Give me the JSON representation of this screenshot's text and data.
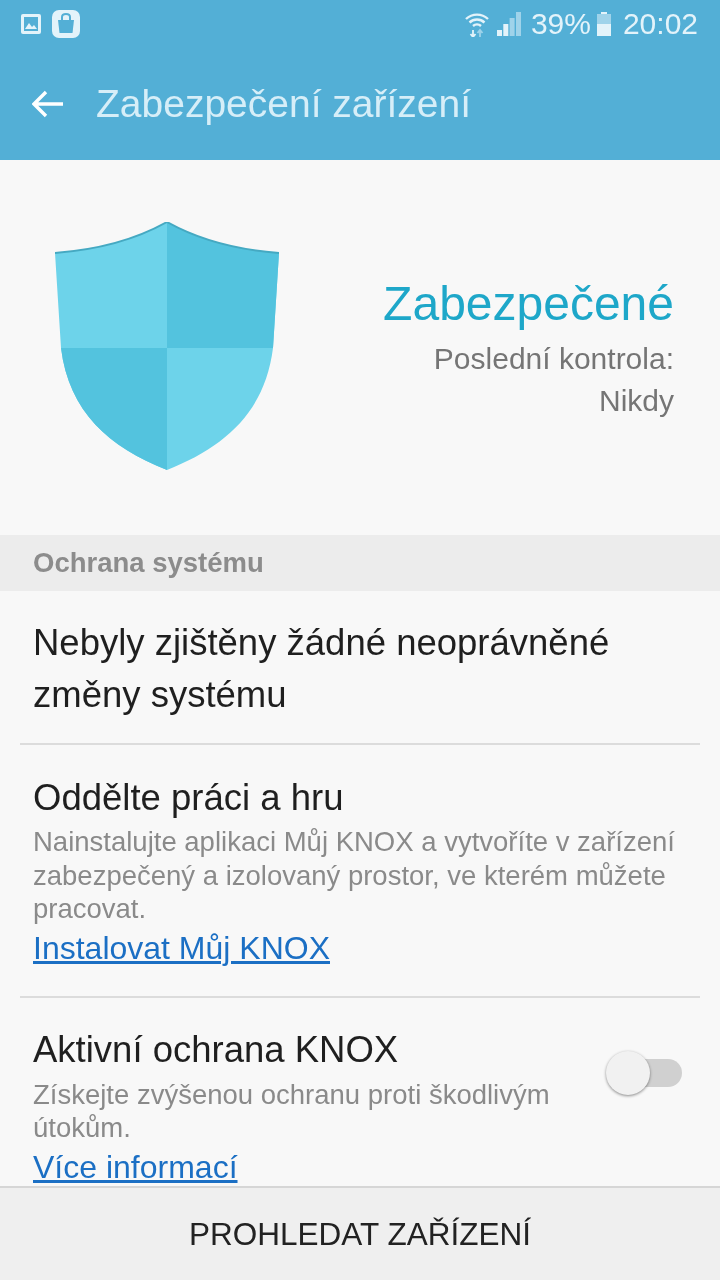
{
  "status_bar": {
    "battery_text": "39%",
    "time": "20:02"
  },
  "app_bar": {
    "title": "Zabezpečení zařízení"
  },
  "status_panel": {
    "status": "Zabezpečené",
    "last_check_label": "Poslední kontrola:",
    "last_check_value": "Nikdy"
  },
  "section": {
    "title": "Ochrana systému"
  },
  "items": [
    {
      "kind": "info",
      "title": "Nebyly zjištěny žádné neoprávněné změny systému"
    },
    {
      "kind": "link",
      "title": "Oddělte práci a hru",
      "description": "Nainstalujte aplikaci Můj KNOX a vytvoříte v zařízení zabezpečený a izolovaný prostor, ve kterém můžete pracovat.",
      "link": "Instalovat Můj KNOX"
    },
    {
      "kind": "toggle",
      "title": "Aktivní ochrana KNOX",
      "description": "Získejte zvýšenou ochranu proti škodlivým útokům.",
      "link": "Více informací",
      "on": false
    }
  ],
  "bottom_button": {
    "label": "PROHLEDAT ZAŘÍZENÍ"
  }
}
